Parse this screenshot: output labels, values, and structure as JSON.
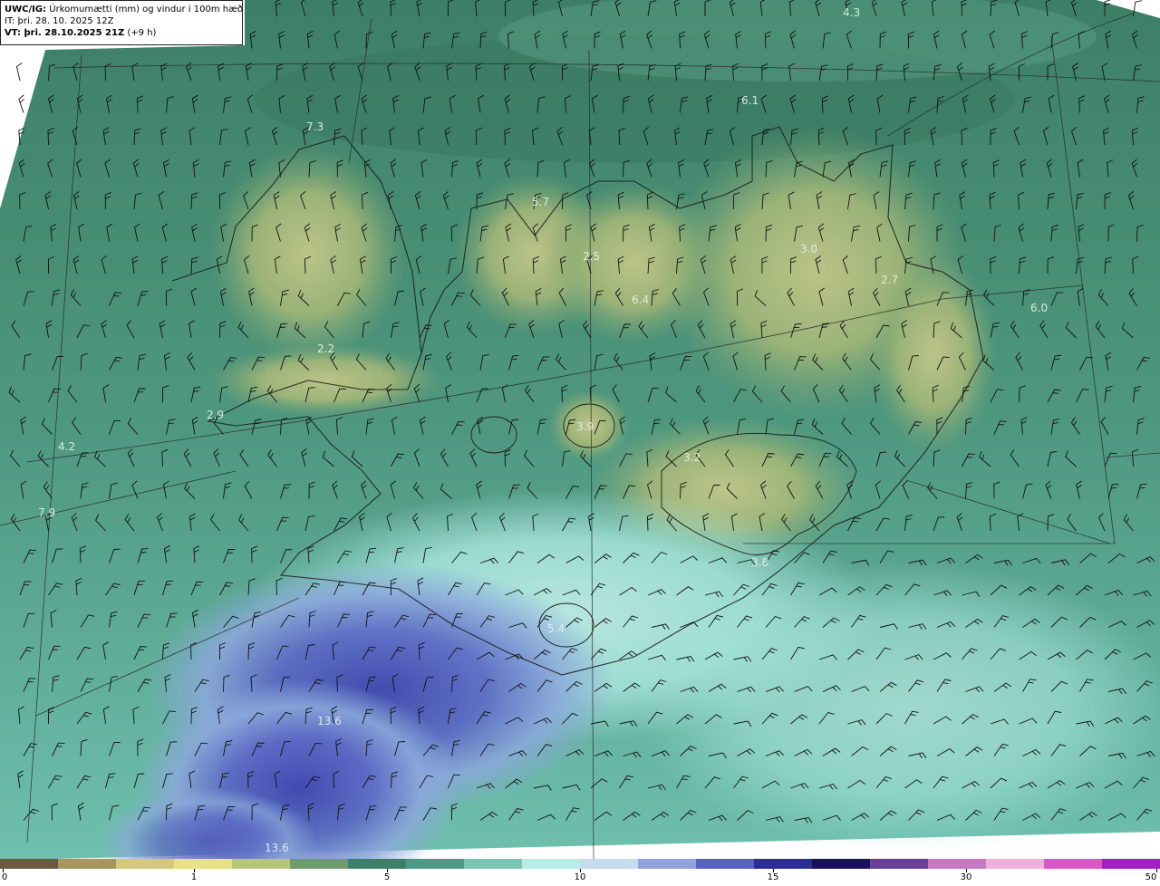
{
  "header": {
    "product": "UWC/IG:",
    "description": "Úrkomumætti (mm) og vindur i 100m hæð",
    "initial_time": "IT: þri. 28. 10. 2025 12Z",
    "valid_prefix": "VT: þri. 28.10.2025 21Z",
    "valid_offset": "(+9 h)"
  },
  "value_labels": [
    "4.3",
    "6.1",
    "7.3",
    "5.7",
    "2.5",
    "3.0",
    "2.7",
    "6.0",
    "6.4",
    "2.2",
    "3.9",
    "2.9",
    "4.2",
    "3.2",
    "7.9",
    "3.8",
    "5.4",
    "13.6",
    "13.6"
  ],
  "colorbar": {
    "ticks": [
      "0",
      "1",
      "5",
      "10",
      "15",
      "30",
      "50"
    ],
    "colors": [
      "#6b5a3e",
      "#a89560",
      "#d4c87a",
      "#e8e08a",
      "#b5c77a",
      "#6e9c6a",
      "#3f7f68",
      "#4f9a84",
      "#7cc5b2",
      "#b8ece6",
      "#c5dcef",
      "#8fa2d9",
      "#5860c0",
      "#2c2d94",
      "#1a0f5c",
      "#6a3fa0",
      "#c47ac0",
      "#f0b0dc",
      "#d858c8",
      "#a020c0"
    ]
  }
}
